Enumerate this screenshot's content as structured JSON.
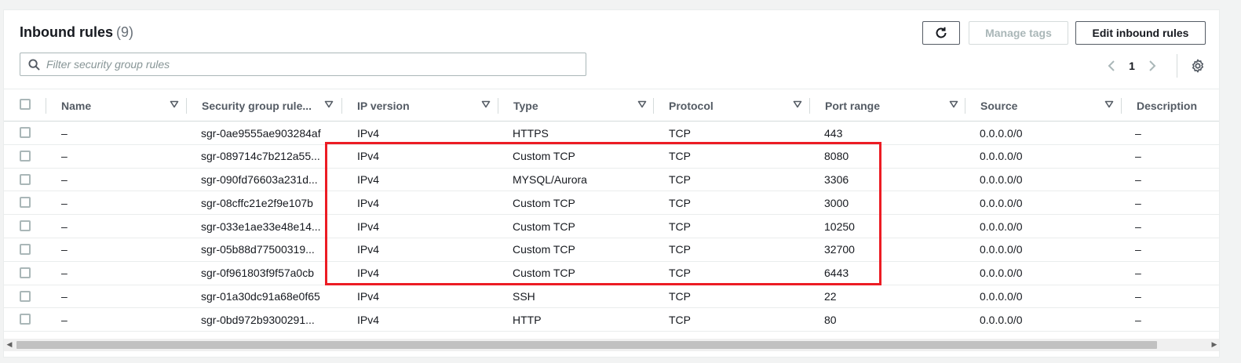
{
  "header": {
    "title": "Inbound rules",
    "count": "(9)"
  },
  "actions": {
    "refresh_icon": "refresh-icon",
    "manage_tags": "Manage tags",
    "edit_inbound": "Edit inbound rules"
  },
  "search": {
    "placeholder": "Filter security group rules",
    "value": ""
  },
  "pagination": {
    "current_page": "1"
  },
  "columns": [
    "Name",
    "Security group rule...",
    "IP version",
    "Type",
    "Protocol",
    "Port range",
    "Source",
    "Description"
  ],
  "rows": [
    {
      "name": "–",
      "rule_id": "sgr-0ae9555ae903284af",
      "ip_version": "IPv4",
      "type": "HTTPS",
      "protocol": "TCP",
      "port_range": "443",
      "source": "0.0.0.0/0",
      "description": "–"
    },
    {
      "name": "–",
      "rule_id": "sgr-089714c7b212a55...",
      "ip_version": "IPv4",
      "type": "Custom TCP",
      "protocol": "TCP",
      "port_range": "8080",
      "source": "0.0.0.0/0",
      "description": "–"
    },
    {
      "name": "–",
      "rule_id": "sgr-090fd76603a231d...",
      "ip_version": "IPv4",
      "type": "MYSQL/Aurora",
      "protocol": "TCP",
      "port_range": "3306",
      "source": "0.0.0.0/0",
      "description": "–"
    },
    {
      "name": "–",
      "rule_id": "sgr-08cffc21e2f9e107b",
      "ip_version": "IPv4",
      "type": "Custom TCP",
      "protocol": "TCP",
      "port_range": "3000",
      "source": "0.0.0.0/0",
      "description": "–"
    },
    {
      "name": "–",
      "rule_id": "sgr-033e1ae33e48e14...",
      "ip_version": "IPv4",
      "type": "Custom TCP",
      "protocol": "TCP",
      "port_range": "10250",
      "source": "0.0.0.0/0",
      "description": "–"
    },
    {
      "name": "–",
      "rule_id": "sgr-05b88d77500319...",
      "ip_version": "IPv4",
      "type": "Custom TCP",
      "protocol": "TCP",
      "port_range": "32700",
      "source": "0.0.0.0/0",
      "description": "–"
    },
    {
      "name": "–",
      "rule_id": "sgr-0f961803f9f57a0cb",
      "ip_version": "IPv4",
      "type": "Custom TCP",
      "protocol": "TCP",
      "port_range": "6443",
      "source": "0.0.0.0/0",
      "description": "–"
    },
    {
      "name": "–",
      "rule_id": "sgr-01a30dc91a68e0f65",
      "ip_version": "IPv4",
      "type": "SSH",
      "protocol": "TCP",
      "port_range": "22",
      "source": "0.0.0.0/0",
      "description": "–"
    },
    {
      "name": "–",
      "rule_id": "sgr-0bd972b9300291...",
      "ip_version": "IPv4",
      "type": "HTTP",
      "protocol": "TCP",
      "port_range": "80",
      "source": "0.0.0.0/0",
      "description": "–"
    }
  ],
  "colors": {
    "highlight": "#ec1c24",
    "text": "#16191f",
    "muted": "#687078"
  }
}
